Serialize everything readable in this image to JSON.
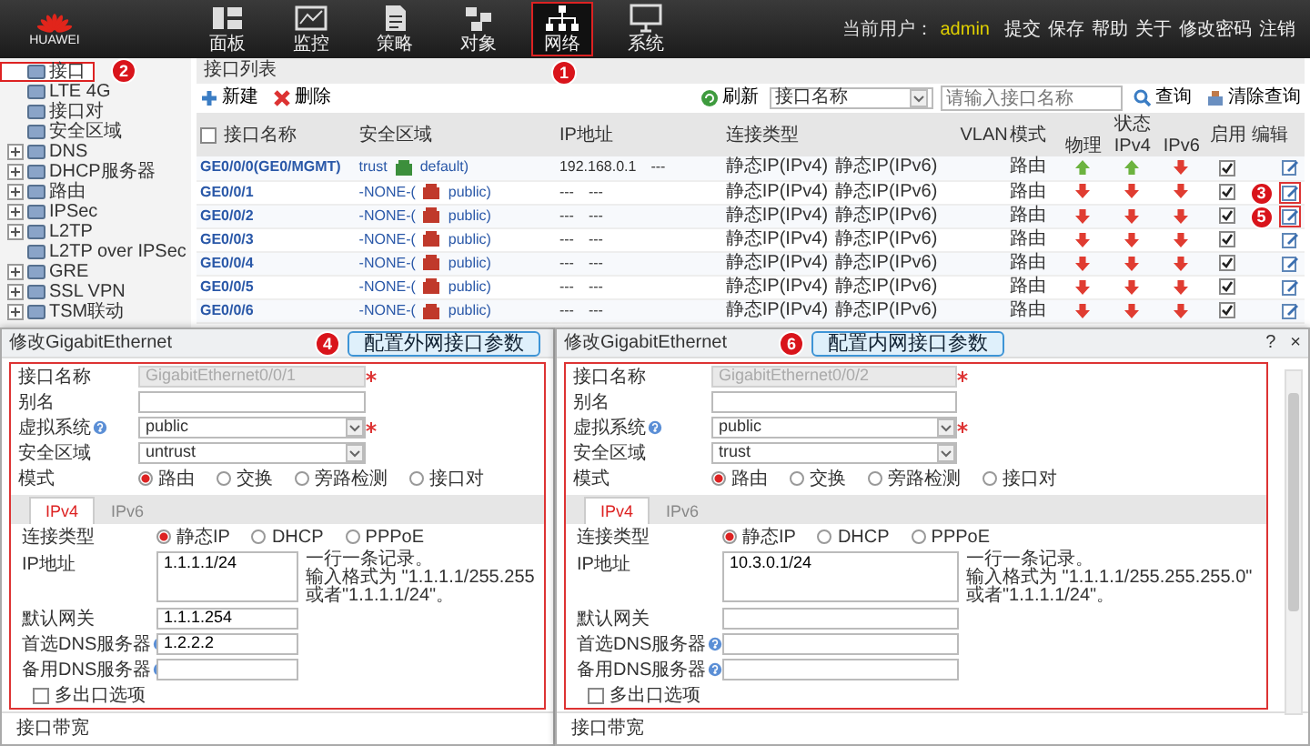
{
  "header": {
    "logo_text": "HUAWEI",
    "nav": [
      {
        "label": "面板",
        "selected": false
      },
      {
        "label": "监控",
        "selected": false
      },
      {
        "label": "策略",
        "selected": false
      },
      {
        "label": "对象",
        "selected": false
      },
      {
        "label": "网络",
        "selected": true,
        "badge": "1"
      },
      {
        "label": "系统",
        "selected": false
      }
    ],
    "user_label": "当前用户：",
    "user": "admin",
    "links": [
      "提交",
      "保存",
      "帮助",
      "关于",
      "修改密码",
      "注销"
    ]
  },
  "sidebar": {
    "items": [
      {
        "label": "接口",
        "selected": true,
        "collapsed": false,
        "badge": "2"
      },
      {
        "label": "LTE 4G",
        "selected": false,
        "collapsed": false
      },
      {
        "label": "接口对",
        "selected": false,
        "collapsed": false
      },
      {
        "label": "安全区域",
        "selected": false,
        "collapsed": false
      },
      {
        "label": "DNS",
        "selected": false,
        "collapsed": true
      },
      {
        "label": "DHCP服务器",
        "selected": false,
        "collapsed": true
      },
      {
        "label": "路由",
        "selected": false,
        "collapsed": true
      },
      {
        "label": "IPSec",
        "selected": false,
        "collapsed": true
      },
      {
        "label": "L2TP",
        "selected": false,
        "collapsed": true
      },
      {
        "label": "L2TP over IPSec",
        "selected": false,
        "collapsed": false
      },
      {
        "label": "GRE",
        "selected": false,
        "collapsed": true
      },
      {
        "label": "SSL VPN",
        "selected": false,
        "collapsed": true
      },
      {
        "label": "TSM联动",
        "selected": false,
        "collapsed": true
      }
    ]
  },
  "panel": {
    "title": "接口列表",
    "actions": [
      {
        "label": "新建",
        "kind": "add"
      },
      {
        "label": "删除",
        "kind": "delete"
      }
    ],
    "refresh": "刷新",
    "filter_field": "接口名称",
    "search": {
      "placeholder": "请输入接口名称"
    },
    "search_button": "查询",
    "clear_button": "清除查询"
  },
  "table": {
    "select_all_checked": false,
    "columns": [
      {
        "label": "接口名称"
      },
      {
        "label": "安全区域"
      },
      {
        "label": "IP地址"
      },
      {
        "label": "连接类型"
      },
      {
        "label": "VLAN"
      },
      {
        "label": "模式"
      },
      {
        "label": "状态",
        "subcolumns": [
          "物理",
          "IPv4",
          "IPv6"
        ]
      },
      {
        "label": "启用"
      },
      {
        "label": "编辑"
      }
    ],
    "rows": [
      {
        "name": "GE0/0/0(GE0/MGMT)",
        "zone": "trust",
        "color": "#3c8f3c",
        "vsys": "default)",
        "ip": [
          "192.168.0.1",
          "---"
        ],
        "connection": [
          "静态IP(IPv4)",
          "静态IP(IPv6)"
        ],
        "mode": "路由",
        "physical_up": true,
        "ipv4_up": true,
        "ipv6_up": false,
        "enabled": true
      },
      {
        "name": "GE0/0/1",
        "zone": "-NONE-(",
        "color": "#c0392b",
        "vsys": "public)",
        "ip": [
          "---",
          "---"
        ],
        "connection": [
          "静态IP(IPv4)",
          "静态IP(IPv6)"
        ],
        "mode": "路由",
        "physical_up": false,
        "ipv4_up": false,
        "ipv6_up": false,
        "enabled": true,
        "edit_badge": "3"
      },
      {
        "name": "GE0/0/2",
        "zone": "-NONE-(",
        "color": "#c0392b",
        "vsys": "public)",
        "ip": [
          "---",
          "---"
        ],
        "connection": [
          "静态IP(IPv4)",
          "静态IP(IPv6)"
        ],
        "mode": "路由",
        "physical_up": false,
        "ipv4_up": false,
        "ipv6_up": false,
        "enabled": true,
        "edit_badge": "5"
      },
      {
        "name": "GE0/0/3",
        "zone": "-NONE-(",
        "color": "#c0392b",
        "vsys": "public)",
        "ip": [
          "---",
          "---"
        ],
        "connection": [
          "静态IP(IPv4)",
          "静态IP(IPv6)"
        ],
        "mode": "路由",
        "physical_up": false,
        "ipv4_up": false,
        "ipv6_up": false,
        "enabled": true
      },
      {
        "name": "GE0/0/4",
        "zone": "-NONE-(",
        "color": "#c0392b",
        "vsys": "public)",
        "ip": [
          "---",
          "---"
        ],
        "connection": [
          "静态IP(IPv4)",
          "静态IP(IPv6)"
        ],
        "mode": "路由",
        "physical_up": false,
        "ipv4_up": false,
        "ipv6_up": false,
        "enabled": true
      },
      {
        "name": "GE0/0/5",
        "zone": "-NONE-(",
        "color": "#c0392b",
        "vsys": "public)",
        "ip": [
          "---",
          "---"
        ],
        "connection": [
          "静态IP(IPv4)",
          "静态IP(IPv6)"
        ],
        "mode": "路由",
        "physical_up": false,
        "ipv4_up": false,
        "ipv6_up": false,
        "enabled": true
      },
      {
        "name": "GE0/0/6",
        "zone": "-NONE-(",
        "color": "#c0392b",
        "vsys": "public)",
        "ip": [
          "---",
          "---"
        ],
        "connection": [
          "静态IP(IPv4)",
          "静态IP(IPv6)"
        ],
        "mode": "路由",
        "physical_up": false,
        "ipv4_up": false,
        "ipv6_up": false,
        "enabled": true
      }
    ]
  },
  "dialogs": [
    {
      "title": "修改GigabitEthernet",
      "badge": "4",
      "callout": "配置外网接口参数",
      "highlighted": true,
      "scrollbar": false,
      "fields": [
        {
          "kind": "text",
          "label": "接口名称",
          "value": "GigabitEthernet0/0/1",
          "disabled": true,
          "required": true,
          "help": false
        },
        {
          "kind": "text",
          "label": "别名",
          "disabled": false,
          "required": false,
          "help": false
        },
        {
          "kind": "select",
          "label": "虚拟系统",
          "value": "public",
          "help": true,
          "required": true
        },
        {
          "kind": "select",
          "label": "安全区域",
          "value": "untrust",
          "help": false,
          "required": false
        },
        {
          "kind": "radio",
          "label": "模式",
          "options": [
            {
              "label": "路由",
              "selected": true
            },
            {
              "label": "交换",
              "selected": false
            },
            {
              "label": "旁路检测",
              "selected": false
            },
            {
              "label": "接口对",
              "selected": false
            }
          ]
        }
      ],
      "tabs": [
        {
          "label": "IPv4",
          "selected": true
        },
        {
          "label": "IPv6",
          "selected": false
        }
      ],
      "tab_fields": [
        {
          "kind": "radio",
          "label": "连接类型",
          "options": [
            {
              "label": "静态IP",
              "selected": true
            },
            {
              "label": "DHCP",
              "selected": false
            },
            {
              "label": "PPPoE",
              "selected": false
            }
          ]
        },
        {
          "kind": "textarea",
          "label": "IP地址",
          "value": "1.1.1.1/24",
          "hint": [
            "一行一条记录。",
            "输入格式为 \"1.1.1.1/255.255",
            "或者\"1.1.1.1/24\"。"
          ]
        },
        {
          "kind": "text",
          "label": "默认网关",
          "value": "1.1.1.254",
          "help": false
        },
        {
          "kind": "text",
          "label": "首选DNS服务器",
          "value": "1.2.2.2",
          "help": true
        },
        {
          "kind": "text",
          "label": "备用DNS服务器",
          "help": true
        },
        {
          "kind": "checkbox",
          "label": "多出口选项",
          "checked": false
        }
      ],
      "footer": "接口带宽"
    },
    {
      "title": "修改GigabitEthernet",
      "badge": "6",
      "callout": "配置内网接口参数",
      "highlighted": true,
      "scrollbar": true,
      "title_buttons": [
        "?",
        "×"
      ],
      "fields": [
        {
          "kind": "text",
          "label": "接口名称",
          "value": "GigabitEthernet0/0/2",
          "disabled": true,
          "required": true,
          "help": false
        },
        {
          "kind": "text",
          "label": "别名",
          "disabled": false,
          "required": false,
          "help": false
        },
        {
          "kind": "select",
          "label": "虚拟系统",
          "value": "public",
          "help": true,
          "required": true
        },
        {
          "kind": "select",
          "label": "安全区域",
          "value": "trust",
          "help": false,
          "required": false
        },
        {
          "kind": "radio",
          "label": "模式",
          "options": [
            {
              "label": "路由",
              "selected": true
            },
            {
              "label": "交换",
              "selected": false
            },
            {
              "label": "旁路检测",
              "selected": false
            },
            {
              "label": "接口对",
              "selected": false
            }
          ]
        }
      ],
      "tabs": [
        {
          "label": "IPv4",
          "selected": true
        },
        {
          "label": "IPv6",
          "selected": false
        }
      ],
      "tab_fields": [
        {
          "kind": "radio",
          "label": "连接类型",
          "options": [
            {
              "label": "静态IP",
              "selected": true
            },
            {
              "label": "DHCP",
              "selected": false
            },
            {
              "label": "PPPoE",
              "selected": false
            }
          ]
        },
        {
          "kind": "textarea",
          "label": "IP地址",
          "value": "10.3.0.1/24",
          "hint": [
            "一行一条记录。",
            "输入格式为 \"1.1.1.1/255.255.255.0\"",
            "或者\"1.1.1.1/24\"。"
          ]
        },
        {
          "kind": "text",
          "label": "默认网关",
          "help": false
        },
        {
          "kind": "text",
          "label": "首选DNS服务器",
          "help": true
        },
        {
          "kind": "text",
          "label": "备用DNS服务器",
          "help": true
        },
        {
          "kind": "checkbox",
          "label": "多出口选项",
          "checked": false
        }
      ],
      "footer": "接口带宽"
    }
  ]
}
